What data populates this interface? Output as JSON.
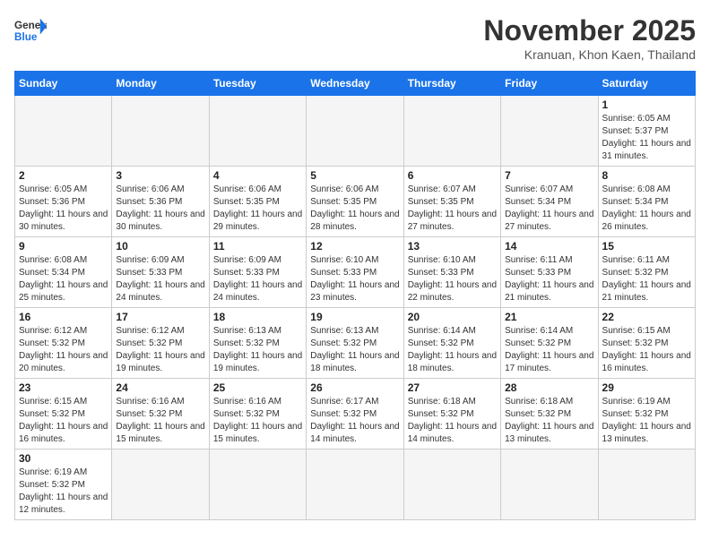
{
  "header": {
    "logo_general": "General",
    "logo_blue": "Blue",
    "month_title": "November 2025",
    "location": "Kranuan, Khon Kaen, Thailand"
  },
  "weekdays": [
    "Sunday",
    "Monday",
    "Tuesday",
    "Wednesday",
    "Thursday",
    "Friday",
    "Saturday"
  ],
  "weeks": [
    [
      {
        "day": "",
        "sunrise": "",
        "sunset": "",
        "daylight": "",
        "empty": true
      },
      {
        "day": "",
        "sunrise": "",
        "sunset": "",
        "daylight": "",
        "empty": true
      },
      {
        "day": "",
        "sunrise": "",
        "sunset": "",
        "daylight": "",
        "empty": true
      },
      {
        "day": "",
        "sunrise": "",
        "sunset": "",
        "daylight": "",
        "empty": true
      },
      {
        "day": "",
        "sunrise": "",
        "sunset": "",
        "daylight": "",
        "empty": true
      },
      {
        "day": "",
        "sunrise": "",
        "sunset": "",
        "daylight": "",
        "empty": true
      },
      {
        "day": "1",
        "sunrise": "Sunrise: 6:05 AM",
        "sunset": "Sunset: 5:37 PM",
        "daylight": "Daylight: 11 hours and 31 minutes.",
        "empty": false
      }
    ],
    [
      {
        "day": "2",
        "sunrise": "Sunrise: 6:05 AM",
        "sunset": "Sunset: 5:36 PM",
        "daylight": "Daylight: 11 hours and 30 minutes.",
        "empty": false
      },
      {
        "day": "3",
        "sunrise": "Sunrise: 6:06 AM",
        "sunset": "Sunset: 5:36 PM",
        "daylight": "Daylight: 11 hours and 30 minutes.",
        "empty": false
      },
      {
        "day": "4",
        "sunrise": "Sunrise: 6:06 AM",
        "sunset": "Sunset: 5:35 PM",
        "daylight": "Daylight: 11 hours and 29 minutes.",
        "empty": false
      },
      {
        "day": "5",
        "sunrise": "Sunrise: 6:06 AM",
        "sunset": "Sunset: 5:35 PM",
        "daylight": "Daylight: 11 hours and 28 minutes.",
        "empty": false
      },
      {
        "day": "6",
        "sunrise": "Sunrise: 6:07 AM",
        "sunset": "Sunset: 5:35 PM",
        "daylight": "Daylight: 11 hours and 27 minutes.",
        "empty": false
      },
      {
        "day": "7",
        "sunrise": "Sunrise: 6:07 AM",
        "sunset": "Sunset: 5:34 PM",
        "daylight": "Daylight: 11 hours and 27 minutes.",
        "empty": false
      },
      {
        "day": "8",
        "sunrise": "Sunrise: 6:08 AM",
        "sunset": "Sunset: 5:34 PM",
        "daylight": "Daylight: 11 hours and 26 minutes.",
        "empty": false
      }
    ],
    [
      {
        "day": "9",
        "sunrise": "Sunrise: 6:08 AM",
        "sunset": "Sunset: 5:34 PM",
        "daylight": "Daylight: 11 hours and 25 minutes.",
        "empty": false
      },
      {
        "day": "10",
        "sunrise": "Sunrise: 6:09 AM",
        "sunset": "Sunset: 5:33 PM",
        "daylight": "Daylight: 11 hours and 24 minutes.",
        "empty": false
      },
      {
        "day": "11",
        "sunrise": "Sunrise: 6:09 AM",
        "sunset": "Sunset: 5:33 PM",
        "daylight": "Daylight: 11 hours and 24 minutes.",
        "empty": false
      },
      {
        "day": "12",
        "sunrise": "Sunrise: 6:10 AM",
        "sunset": "Sunset: 5:33 PM",
        "daylight": "Daylight: 11 hours and 23 minutes.",
        "empty": false
      },
      {
        "day": "13",
        "sunrise": "Sunrise: 6:10 AM",
        "sunset": "Sunset: 5:33 PM",
        "daylight": "Daylight: 11 hours and 22 minutes.",
        "empty": false
      },
      {
        "day": "14",
        "sunrise": "Sunrise: 6:11 AM",
        "sunset": "Sunset: 5:33 PM",
        "daylight": "Daylight: 11 hours and 21 minutes.",
        "empty": false
      },
      {
        "day": "15",
        "sunrise": "Sunrise: 6:11 AM",
        "sunset": "Sunset: 5:32 PM",
        "daylight": "Daylight: 11 hours and 21 minutes.",
        "empty": false
      }
    ],
    [
      {
        "day": "16",
        "sunrise": "Sunrise: 6:12 AM",
        "sunset": "Sunset: 5:32 PM",
        "daylight": "Daylight: 11 hours and 20 minutes.",
        "empty": false
      },
      {
        "day": "17",
        "sunrise": "Sunrise: 6:12 AM",
        "sunset": "Sunset: 5:32 PM",
        "daylight": "Daylight: 11 hours and 19 minutes.",
        "empty": false
      },
      {
        "day": "18",
        "sunrise": "Sunrise: 6:13 AM",
        "sunset": "Sunset: 5:32 PM",
        "daylight": "Daylight: 11 hours and 19 minutes.",
        "empty": false
      },
      {
        "day": "19",
        "sunrise": "Sunrise: 6:13 AM",
        "sunset": "Sunset: 5:32 PM",
        "daylight": "Daylight: 11 hours and 18 minutes.",
        "empty": false
      },
      {
        "day": "20",
        "sunrise": "Sunrise: 6:14 AM",
        "sunset": "Sunset: 5:32 PM",
        "daylight": "Daylight: 11 hours and 18 minutes.",
        "empty": false
      },
      {
        "day": "21",
        "sunrise": "Sunrise: 6:14 AM",
        "sunset": "Sunset: 5:32 PM",
        "daylight": "Daylight: 11 hours and 17 minutes.",
        "empty": false
      },
      {
        "day": "22",
        "sunrise": "Sunrise: 6:15 AM",
        "sunset": "Sunset: 5:32 PM",
        "daylight": "Daylight: 11 hours and 16 minutes.",
        "empty": false
      }
    ],
    [
      {
        "day": "23",
        "sunrise": "Sunrise: 6:15 AM",
        "sunset": "Sunset: 5:32 PM",
        "daylight": "Daylight: 11 hours and 16 minutes.",
        "empty": false
      },
      {
        "day": "24",
        "sunrise": "Sunrise: 6:16 AM",
        "sunset": "Sunset: 5:32 PM",
        "daylight": "Daylight: 11 hours and 15 minutes.",
        "empty": false
      },
      {
        "day": "25",
        "sunrise": "Sunrise: 6:16 AM",
        "sunset": "Sunset: 5:32 PM",
        "daylight": "Daylight: 11 hours and 15 minutes.",
        "empty": false
      },
      {
        "day": "26",
        "sunrise": "Sunrise: 6:17 AM",
        "sunset": "Sunset: 5:32 PM",
        "daylight": "Daylight: 11 hours and 14 minutes.",
        "empty": false
      },
      {
        "day": "27",
        "sunrise": "Sunrise: 6:18 AM",
        "sunset": "Sunset: 5:32 PM",
        "daylight": "Daylight: 11 hours and 14 minutes.",
        "empty": false
      },
      {
        "day": "28",
        "sunrise": "Sunrise: 6:18 AM",
        "sunset": "Sunset: 5:32 PM",
        "daylight": "Daylight: 11 hours and 13 minutes.",
        "empty": false
      },
      {
        "day": "29",
        "sunrise": "Sunrise: 6:19 AM",
        "sunset": "Sunset: 5:32 PM",
        "daylight": "Daylight: 11 hours and 13 minutes.",
        "empty": false
      }
    ],
    [
      {
        "day": "30",
        "sunrise": "Sunrise: 6:19 AM",
        "sunset": "Sunset: 5:32 PM",
        "daylight": "Daylight: 11 hours and 12 minutes.",
        "empty": false
      },
      {
        "day": "",
        "empty": true
      },
      {
        "day": "",
        "empty": true
      },
      {
        "day": "",
        "empty": true
      },
      {
        "day": "",
        "empty": true
      },
      {
        "day": "",
        "empty": true
      },
      {
        "day": "",
        "empty": true
      }
    ]
  ]
}
